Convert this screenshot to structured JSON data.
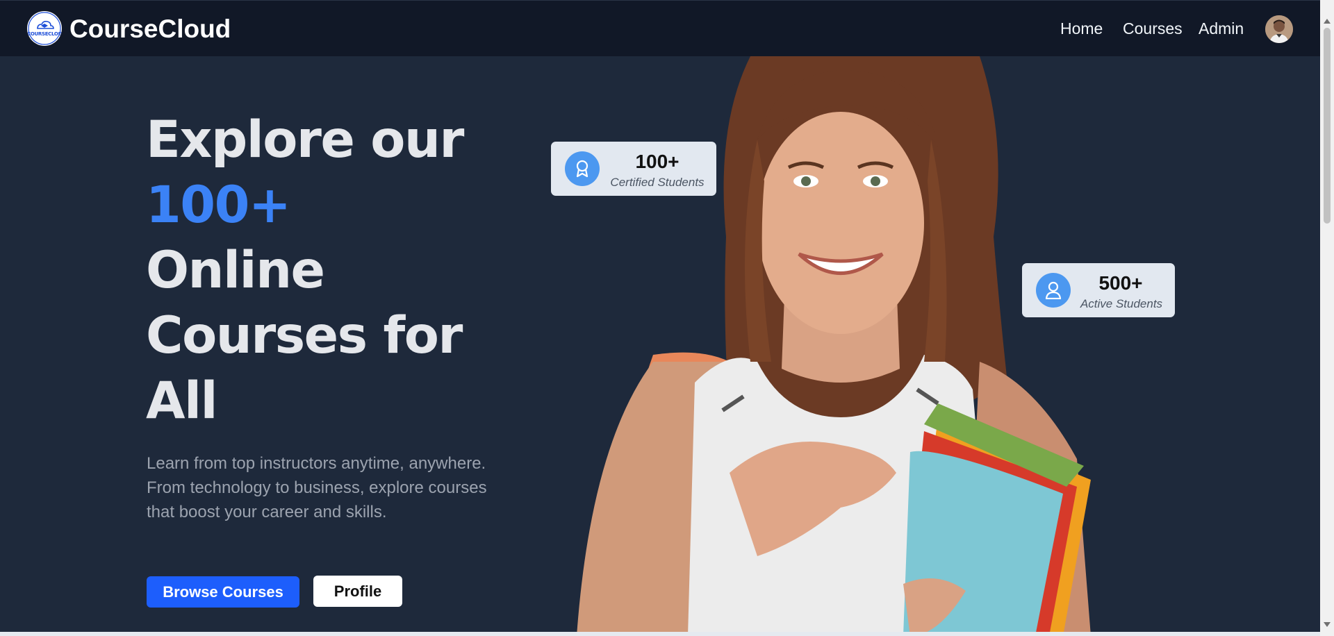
{
  "nav": {
    "logo_text": "COURSECLOUD",
    "brand": "CourseCloud",
    "links": [
      "Home",
      "Courses",
      "Admin"
    ]
  },
  "hero": {
    "title_line1": "Explore our",
    "title_accent": "100+",
    "title_line3": "Online",
    "title_line4": "Courses for",
    "title_line5": "All",
    "description": "Learn from top instructors anytime, anywhere. From technology to business, explore courses that boost your career and skills.",
    "primary_button": "Browse Courses",
    "secondary_button": "Profile"
  },
  "stats": [
    {
      "number": "100+",
      "label": "Certified Students",
      "icon": "award-icon"
    },
    {
      "number": "500+",
      "label": "Active Students",
      "icon": "user-icon"
    }
  ],
  "colors": {
    "background": "#1e293b",
    "nav_background": "#111827",
    "accent": "#3b82f6",
    "button_primary": "#1d5efc",
    "stat_icon": "#4c98f0"
  }
}
